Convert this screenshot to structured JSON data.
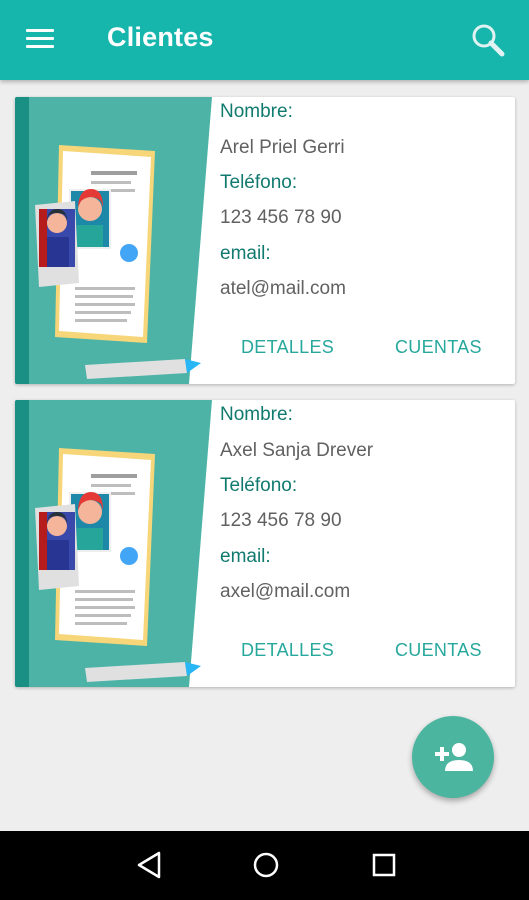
{
  "app_bar": {
    "title": "Clientes",
    "menu_icon": "menu-icon",
    "search_icon": "search-icon",
    "color": "#17b6ac"
  },
  "clients": [
    {
      "name_label": "Nombre:",
      "name": "Arel Priel Gerri",
      "phone_label": "Teléfono:",
      "phone": "123 456 78 90",
      "email_label": "email:",
      "email": "atel@mail.com",
      "details_button": "DETALLES",
      "accounts_button": "CUENTAS"
    },
    {
      "name_label": "Nombre:",
      "name": "Axel Sanja Drever",
      "phone_label": "Teléfono:",
      "phone": "123 456 78 90",
      "email_label": "email:",
      "email": "axel@mail.com",
      "details_button": "DETALLES",
      "accounts_button": "CUENTAS"
    }
  ],
  "fab": {
    "icon": "add-person-icon",
    "color": "#4bb59f"
  },
  "nav_bar": {
    "back_icon": "back-triangle-icon",
    "home_icon": "home-circle-icon",
    "recents_icon": "recents-square-icon"
  }
}
